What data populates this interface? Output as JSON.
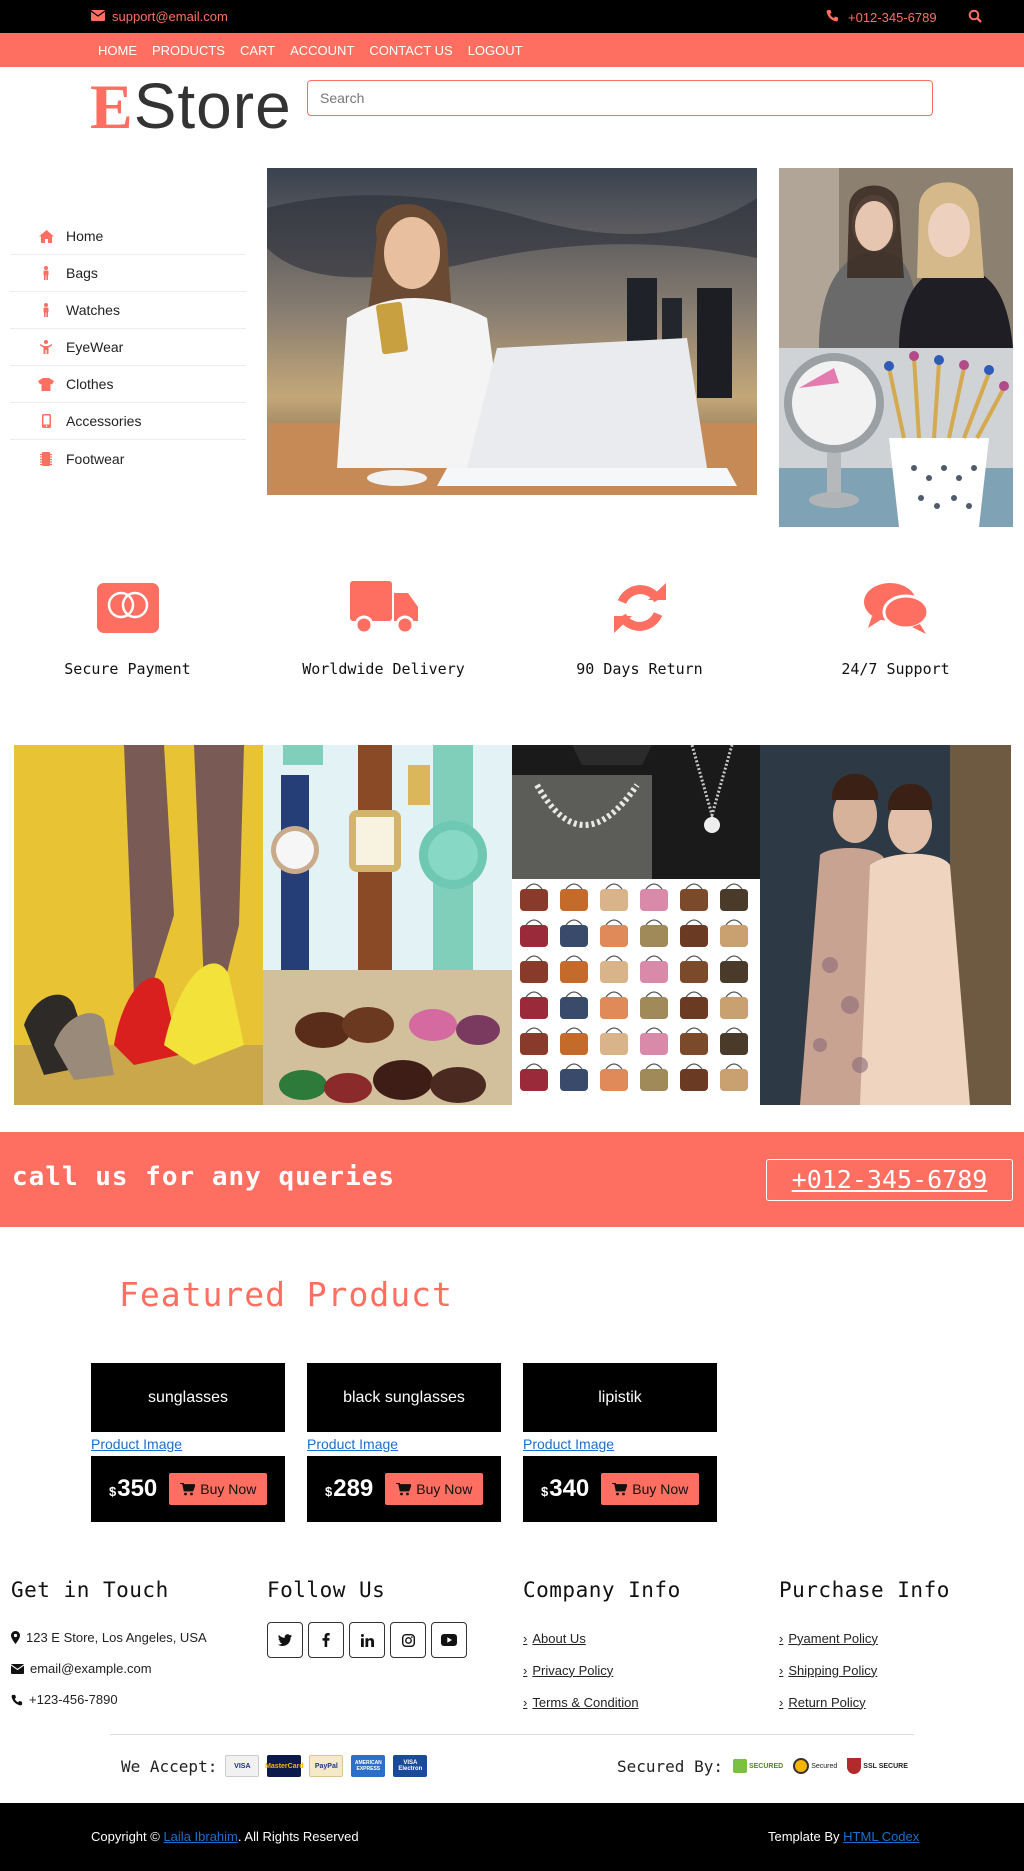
{
  "topbar": {
    "email": "support@email.com",
    "phone": "+012-345-6789",
    "icons": [
      "envelope-icon",
      "phone-icon",
      "search-icon"
    ]
  },
  "nav": {
    "items": [
      "HOME",
      "PRODUCTS",
      "CART",
      "ACCOUNT",
      "CONTACT US",
      "LOGOUT"
    ]
  },
  "brand": {
    "first": "E",
    "rest": "Store"
  },
  "search": {
    "placeholder": "Search",
    "value": ""
  },
  "categories": [
    {
      "label": "Home",
      "icon": "home-icon"
    },
    {
      "label": "Bags",
      "icon": "person-icon"
    },
    {
      "label": "Watches",
      "icon": "person-icon"
    },
    {
      "label": "EyeWear",
      "icon": "child-icon"
    },
    {
      "label": "Clothes",
      "icon": "shirt-icon"
    },
    {
      "label": "Accessories",
      "icon": "mobile-icon"
    },
    {
      "label": "Footwear",
      "icon": "microchip-icon"
    }
  ],
  "features": [
    {
      "label": "Secure Payment",
      "icon": "mastercard-icon",
      "card_text": "mastercard"
    },
    {
      "label": "Worldwide Delivery",
      "icon": "truck-icon"
    },
    {
      "label": "90 Days Return",
      "icon": "sync-icon"
    },
    {
      "label": "24/7 Support",
      "icon": "comments-icon"
    }
  ],
  "call": {
    "text": "call us for any queries",
    "phone": "+012-345-6789"
  },
  "featured": {
    "title": "Featured Product",
    "products": [
      {
        "name": "sunglasses",
        "image_alt": "Product Image",
        "currency": "$",
        "price": "350",
        "button": "Buy Now"
      },
      {
        "name": "black sunglasses",
        "image_alt": "Product Image",
        "currency": "$",
        "price": "289",
        "button": "Buy Now"
      },
      {
        "name": "lipistik",
        "image_alt": "Product Image",
        "currency": "$",
        "price": "340",
        "button": "Buy Now"
      }
    ]
  },
  "footer": {
    "touch": {
      "title": "Get in Touch",
      "address": "123 E Store, Los Angeles, USA",
      "email": "email@example.com",
      "phone": "+123-456-7890"
    },
    "follow": {
      "title": "Follow Us",
      "icons": [
        "twitter-icon",
        "facebook-icon",
        "linkedin-icon",
        "instagram-icon",
        "youtube-icon"
      ]
    },
    "company": {
      "title": "Company Info",
      "links": [
        "About Us",
        "Privacy Policy",
        "Terms & Condition"
      ]
    },
    "purchase": {
      "title": "Purchase Info",
      "links": [
        "Pyament Policy",
        "Shipping Policy",
        "Return Policy"
      ]
    },
    "accept": {
      "label": "We Accept:",
      "cards": [
        "VISA",
        "MasterCard",
        "PayPal",
        "AMERICAN EXPRESS",
        "VISA Electron"
      ]
    },
    "secured": {
      "label": "Secured By:",
      "seals": [
        "SECURED",
        "Secured",
        "SSL SECURE"
      ]
    }
  },
  "bottom": {
    "copy_pre": "Copyright ©",
    "author": "Laila Ibrahim",
    "copy_post": ". All Rights Reserved",
    "template_pre": "Template By",
    "template_link": "HTML Codex"
  },
  "colors": {
    "accent": "#ff6f61",
    "dark": "#000000"
  }
}
